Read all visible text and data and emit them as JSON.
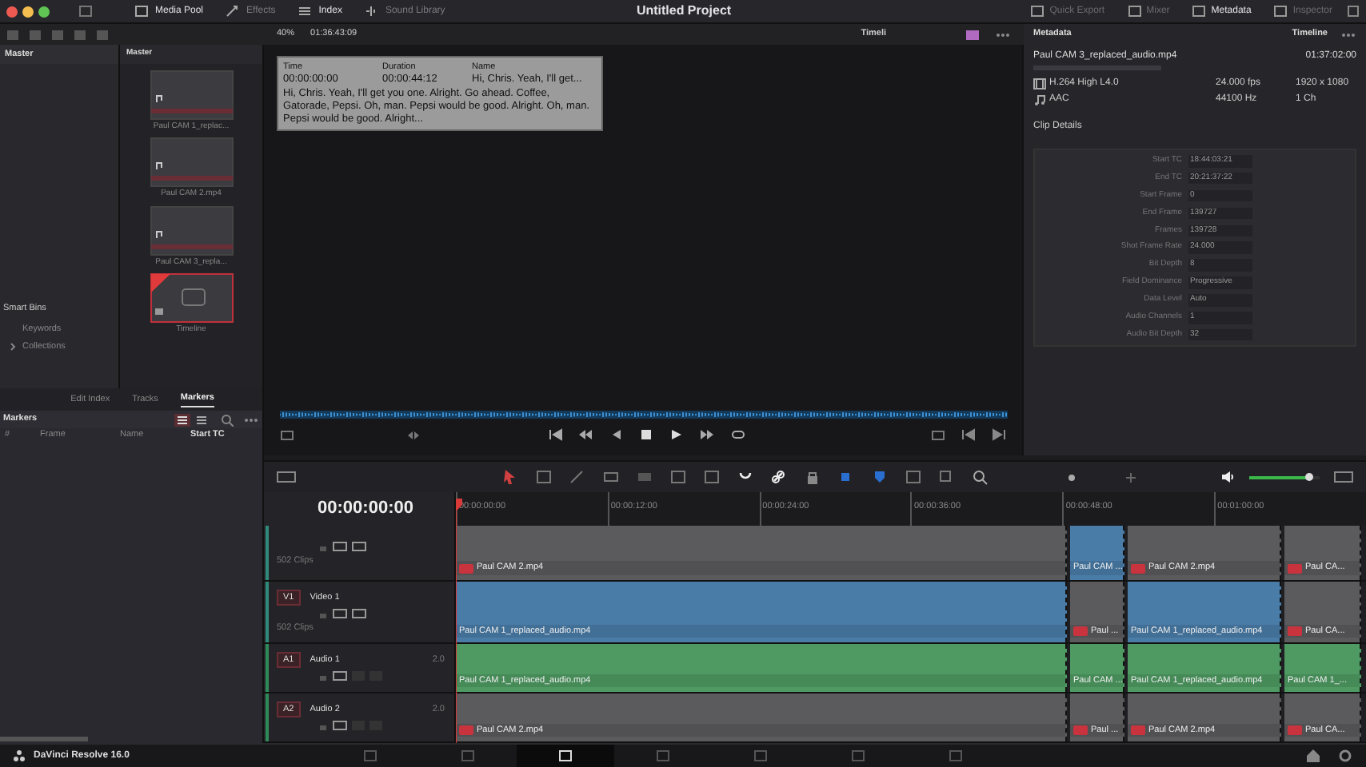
{
  "window": {
    "title": "Untitled Project"
  },
  "top_tabs": [
    {
      "label": "Media Pool",
      "selected": true
    },
    {
      "label": "Effects",
      "selected": false
    },
    {
      "label": "Index",
      "selected": true
    },
    {
      "label": "Sound Library",
      "selected": false
    }
  ],
  "right_tabs": [
    {
      "label": "Quick Export",
      "selected": false
    },
    {
      "label": "Mixer",
      "selected": false
    },
    {
      "label": "Metadata",
      "selected": true
    },
    {
      "label": "Inspector",
      "selected": false
    }
  ],
  "viewer_bar": {
    "zoom": "40%",
    "timecode": "01:36:43:09",
    "timeline_name": "Timeli"
  },
  "bins": {
    "master": "Master",
    "smart_bins": "Smart Bins",
    "items": [
      "Keywords",
      "Collections"
    ]
  },
  "media_pool": {
    "title": "Master",
    "clips": [
      {
        "name": "Paul CAM 1_replac...",
        "kind": "clip",
        "selected": false
      },
      {
        "name": "Paul CAM 2.mp4",
        "kind": "clip",
        "selected": false
      },
      {
        "name": "Paul CAM 3_repla...",
        "kind": "clip",
        "selected": false
      },
      {
        "name": "Timeline",
        "kind": "timeline",
        "selected": true
      }
    ]
  },
  "tooltip": {
    "headers": [
      "Time",
      "Duration",
      "Name"
    ],
    "values": [
      "00:00:00:00",
      "00:00:44:12",
      "Hi, Chris. Yeah, I'll get..."
    ],
    "text": "Hi, Chris. Yeah, I'll get you one. Alright. Go ahead. Coffee, Gatorade, Pepsi. Oh, man. Pepsi would be good. Alright. Oh, man. Pepsi would be good. Alright..."
  },
  "metadata": {
    "title": "Metadata",
    "scope": "Timeline",
    "file": "Paul CAM 3_replaced_audio.mp4",
    "duration": "01:37:02:00",
    "streams": [
      {
        "kind": "video",
        "codec": "H.264 High L4.0",
        "rate": "24.000 fps",
        "format": "1920 x 1080"
      },
      {
        "kind": "audio",
        "codec": "AAC",
        "rate": "44100 Hz",
        "format": "1 Ch"
      }
    ],
    "section": "Clip Details",
    "fields": [
      {
        "label": "Start TC",
        "value": "18:44:03:21"
      },
      {
        "label": "End TC",
        "value": "20:21:37:22"
      },
      {
        "label": "Start Frame",
        "value": "0"
      },
      {
        "label": "End Frame",
        "value": "139727"
      },
      {
        "label": "Frames",
        "value": "139728"
      },
      {
        "label": "Shot Frame Rate",
        "value": "24.000"
      },
      {
        "label": "Bit Depth",
        "value": "8"
      },
      {
        "label": "Field Dominance",
        "value": "Progressive"
      },
      {
        "label": "Data Level",
        "value": "Auto"
      },
      {
        "label": "Audio Channels",
        "value": "1"
      },
      {
        "label": "Audio Bit Depth",
        "value": "32"
      }
    ]
  },
  "lower_tabs": [
    {
      "label": "Edit Index",
      "selected": false
    },
    {
      "label": "Tracks",
      "selected": false
    },
    {
      "label": "Markers",
      "selected": true
    }
  ],
  "markers": {
    "title": "Markers",
    "columns": [
      "#",
      "Frame",
      "Name",
      "Start TC"
    ]
  },
  "volume": {
    "level": 0.85
  },
  "timeline": {
    "timecode": "00:00:00:00",
    "ruler": [
      "00:00:00:00",
      "00:00:12:00",
      "00:00:24:00",
      "00:00:36:00",
      "00:00:48:00",
      "00:01:00:00"
    ],
    "tracks": [
      {
        "kind": "video",
        "info": "502 Clips",
        "clips": [
          {
            "label": "Paul CAM 2.mp4",
            "color": "#5b5b5e",
            "badge": true
          },
          {
            "label": "Paul CAM ...",
            "color": "#4a7ca8",
            "badge": false
          },
          {
            "label": "Paul CAM 2.mp4",
            "color": "#5b5b5e",
            "badge": true
          },
          {
            "label": "Paul CA...",
            "color": "#5b5b5e",
            "badge": true
          }
        ]
      },
      {
        "kind": "video",
        "id": "V1",
        "name": "Video 1",
        "info": "502 Clips",
        "clips": [
          {
            "label": "Paul CAM 1_replaced_audio.mp4",
            "color": "#4a7ca8",
            "badge": false
          },
          {
            "label": "Paul ...",
            "color": "#5b5b5e",
            "badge": true
          },
          {
            "label": "Paul CAM 1_replaced_audio.mp4",
            "color": "#4a7ca8",
            "badge": false
          },
          {
            "label": "Paul CA...",
            "color": "#5b5b5e",
            "badge": true
          }
        ]
      },
      {
        "kind": "audio",
        "id": "A1",
        "name": "Audio 1",
        "info": "2.0",
        "clips": [
          {
            "label": "Paul CAM 1_replaced_audio.mp4",
            "color": "#4f9a62",
            "badge": false
          },
          {
            "label": "Paul CAM ...",
            "color": "#4f9a62",
            "badge": false
          },
          {
            "label": "Paul CAM 1_replaced_audio.mp4",
            "color": "#4f9a62",
            "badge": false
          },
          {
            "label": "Paul CAM 1_...",
            "color": "#4f9a62",
            "badge": false
          }
        ]
      },
      {
        "kind": "audio",
        "id": "A2",
        "name": "Audio 2",
        "info": "2.0",
        "clips": [
          {
            "label": "Paul CAM 2.mp4",
            "color": "#5b5b5e",
            "badge": true
          },
          {
            "label": "Paul ...",
            "color": "#5b5b5e",
            "badge": true
          },
          {
            "label": "Paul CAM 2.mp4",
            "color": "#5b5b5e",
            "badge": true
          },
          {
            "label": "Paul CA...",
            "color": "#5b5b5e",
            "badge": true
          }
        ]
      }
    ]
  },
  "page_tabs": [
    {
      "selected": false
    },
    {
      "selected": false
    },
    {
      "selected": true
    },
    {
      "selected": false
    },
    {
      "selected": false
    },
    {
      "selected": false
    },
    {
      "selected": false
    }
  ],
  "status": {
    "app": "DaVinci Resolve 16.0"
  }
}
